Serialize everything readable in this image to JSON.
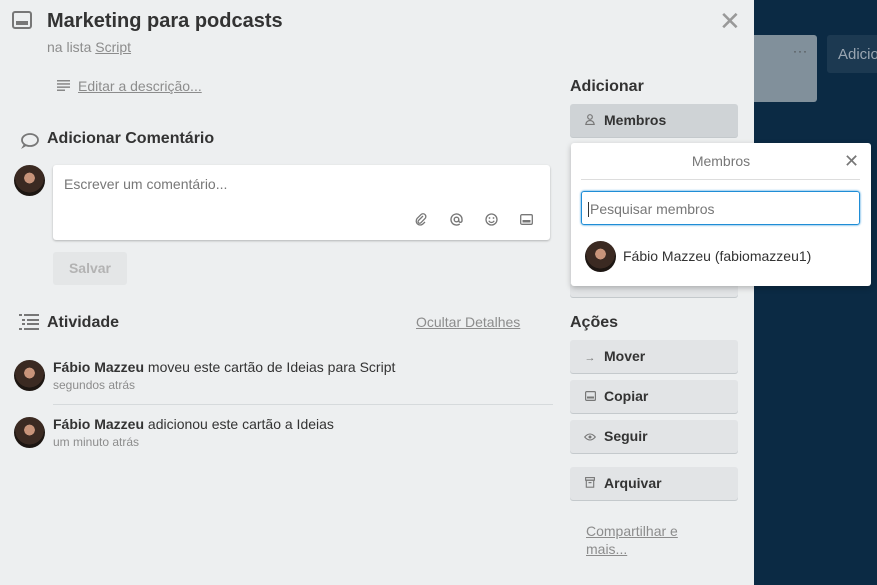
{
  "board": {
    "add_label": "Adicio",
    "card_menu": "···"
  },
  "card": {
    "title": "Marketing para podcasts",
    "in_list_prefix": "na lista",
    "list_name": "Script",
    "edit_description": "Editar a descrição..."
  },
  "comment": {
    "section_title": "Adicionar Comentário",
    "placeholder": "Escrever um comentário...",
    "save_label": "Salvar",
    "icons": [
      "paperclip-icon",
      "mention-icon",
      "emoji-icon",
      "card-icon"
    ]
  },
  "activity": {
    "section_title": "Atividade",
    "hide_details": "Ocultar Detalhes",
    "items": [
      {
        "user": "Fábio Mazzeu",
        "action": "moveu este cartão de Ideias para Script",
        "time": "segundos atrás"
      },
      {
        "user": "Fábio Mazzeu",
        "action": "adicionou este cartão a Ideias",
        "time": "um minuto atrás"
      }
    ]
  },
  "sidebar": {
    "add_title": "Adicionar",
    "members_label": "Membros",
    "actions_title": "Ações",
    "actions": [
      {
        "label": "Mover",
        "icon": "arrow-right-icon"
      },
      {
        "label": "Copiar",
        "icon": "copy-icon"
      },
      {
        "label": "Seguir",
        "icon": "eye-icon"
      },
      {
        "label": "Arquivar",
        "icon": "archive-icon"
      }
    ],
    "share_label": "Compartilhar e mais..."
  },
  "members_popover": {
    "title": "Membros",
    "search_placeholder": "Pesquisar membros",
    "member": "Fábio Mazzeu (fabiomazzeu1)"
  },
  "colors": {
    "board_bg": "#0b2a44",
    "modal_bg": "#edeff0",
    "focus_border": "#1f8dd6"
  }
}
